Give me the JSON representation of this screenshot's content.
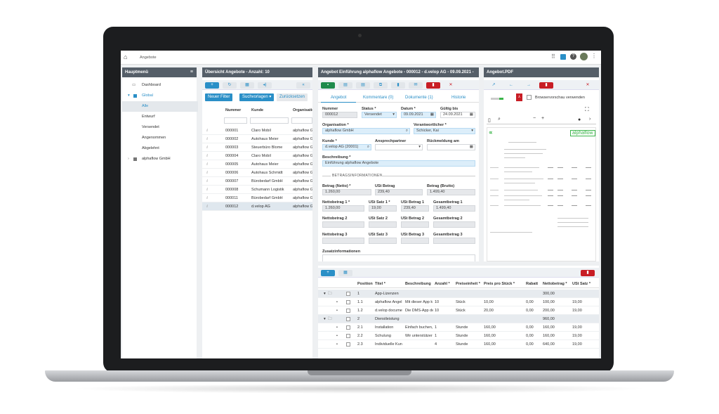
{
  "topbar": {
    "breadcrumb": "Angebote",
    "icons": [
      "home-icon",
      "apps-grid-icon",
      "gift-icon",
      "help-icon",
      "avatar",
      "more-icon"
    ]
  },
  "main_menu": {
    "title": "Hauptmenü",
    "dashboard": "Dashboard",
    "global": "Global",
    "items": [
      "Alle",
      "Entwurf",
      "Versendet",
      "Angenommen",
      "Abgelehnt"
    ],
    "company": "alphaflow GmbH"
  },
  "overview": {
    "title": "Übersicht Angebote - Anzahl: 10",
    "buttons": {
      "new_filter": "Neuer Filter",
      "search_templates": "Suchvorlagen",
      "reset": "Zurücksetzen"
    },
    "columns": [
      "Nummer",
      "Kunde",
      "Organisatio"
    ],
    "rows": [
      {
        "nr": "000001",
        "kunde": "Claro Mobil",
        "org": "alphaflow G"
      },
      {
        "nr": "000002",
        "kunde": "Autohaus Meier",
        "org": "alphaflow G"
      },
      {
        "nr": "000003",
        "kunde": "Steuerbüro Blome",
        "org": "alphaflow G"
      },
      {
        "nr": "000004",
        "kunde": "Claro Mobil",
        "org": "alphaflow G"
      },
      {
        "nr": "000005",
        "kunde": "Autohaus Meier",
        "org": "alphaflow G"
      },
      {
        "nr": "000006",
        "kunde": "Autohaus Schmidt",
        "org": "alphaflow G"
      },
      {
        "nr": "000007",
        "kunde": "Bürobedarf GmbH",
        "org": "alphaflow G"
      },
      {
        "nr": "000008",
        "kunde": "Schumann Logistik",
        "org": "alphaflow G"
      },
      {
        "nr": "000011",
        "kunde": "Bürobedarf GmbH",
        "org": "alphaflow G"
      },
      {
        "nr": "000012",
        "kunde": "d.velop AG",
        "org": "alphaflow G"
      }
    ]
  },
  "detail": {
    "title": "Angebot Einführung alphaflow Angebote - 000012 - d.velop AG - 09.09.2021 -",
    "tabs": [
      "Angebot",
      "Kommentare (0)",
      "Dokumente (1)",
      "Historie"
    ],
    "labels": {
      "nummer": "Nummer",
      "status": "Status *",
      "datum": "Datum *",
      "gueltig": "Gültig bis",
      "organisation": "Organisation *",
      "verantwortlicher": "Verantwortlicher *",
      "kunde": "Kunde *",
      "ansprechpartner": "Ansprechpartner",
      "rueckmeldung": "Rückmeldung am",
      "beschreibung": "Beschreibung *",
      "betrags_section": "BETRAGSINFORMATIONEN",
      "betrag_netto": "Betrag (Netto) *",
      "ust_betrag": "USt Betrag",
      "betrag_brutto": "Betrag (Brutto)",
      "netto1": "Nettobetrag 1 *",
      "ust_satz1": "USt Satz 1 *",
      "ust_betrag1": "USt Betrag 1",
      "gesamt1": "Gesamtbetrag 1",
      "netto2": "Nettobetrag 2",
      "ust_satz2": "USt Satz 2",
      "ust_betrag2": "USt Betrag 2",
      "gesamt2": "Gesamtbetrag 2",
      "netto3": "Nettobetrag 3",
      "ust_satz3": "USt Satz 3",
      "ust_betrag3": "USt Betrag 3",
      "gesamt3": "Gesamtbetrag 3",
      "zusatz": "Zusatzinformationen"
    },
    "values": {
      "nummer": "000012",
      "status": "Versendet",
      "datum": "09.09.2021",
      "gueltig": "24.09.2021",
      "organisation": "alphaflow GmbH",
      "verantwortlicher": "Schicker, Kai",
      "kunde": "d.velop AG (20001)",
      "beschreibung": "Einführung alphaflow Angebote",
      "betrag_netto": "1.260,00",
      "ust_betrag": "239,40",
      "betrag_brutto": "1.499,40",
      "netto1": "1.260,00",
      "ust_satz1": "19,00",
      "ust_betrag1": "239,40",
      "gesamt1": "1.499,40"
    }
  },
  "positions": {
    "columns": [
      "Position",
      "Titel *",
      "Beschreibung",
      "Anzahl *",
      "Preiseinheit *",
      "Preis pro Stück *",
      "Rabatt",
      "Nettobetrag *",
      "USt Satz *"
    ],
    "rows": [
      {
        "pos": "1",
        "titel": "App-Lizenzen",
        "besch": "",
        "anz": "",
        "einh": "",
        "preis": "",
        "rabatt": "",
        "netto": "300,00",
        "ust": "",
        "grp": true
      },
      {
        "pos": "1.1",
        "titel": "alphaflow Angel",
        "besch": "Mit dieser App k",
        "anz": "10",
        "einh": "Stück",
        "preis": "10,00",
        "rabatt": "0,00",
        "netto": "100,00",
        "ust": "19,00",
        "grp": false
      },
      {
        "pos": "1.2",
        "titel": "d.velop docume",
        "besch": "Die DMS-App de",
        "anz": "10",
        "einh": "Stück",
        "preis": "20,00",
        "rabatt": "0,00",
        "netto": "200,00",
        "ust": "19,00",
        "grp": false
      },
      {
        "pos": "2",
        "titel": "Dienstleistung",
        "besch": "",
        "anz": "",
        "einh": "",
        "preis": "",
        "rabatt": "",
        "netto": "960,00",
        "ust": "",
        "grp": true
      },
      {
        "pos": "2.1",
        "titel": "Installation",
        "besch": "Einfach buchen,",
        "anz": "1",
        "einh": "Stunde",
        "preis": "160,00",
        "rabatt": "0,00",
        "netto": "160,00",
        "ust": "19,00",
        "grp": false
      },
      {
        "pos": "2.2",
        "titel": "Schulung",
        "besch": "Wir unterstützer",
        "anz": "1",
        "einh": "Stunde",
        "preis": "160,00",
        "rabatt": "0,00",
        "netto": "160,00",
        "ust": "19,00",
        "grp": false
      },
      {
        "pos": "2.3",
        "titel": "Individuelle Kun",
        "besch": "",
        "anz": "4",
        "einh": "Stunde",
        "preis": "160,00",
        "rabatt": "0,00",
        "netto": "640,00",
        "ust": "19,00",
        "grp": false
      }
    ]
  },
  "pdf": {
    "title": "Angebot.PDF",
    "browser_preview": "Browservorschau verwenden",
    "logo": "alphaflow"
  },
  "colors": {
    "header": "#555e68",
    "accent": "#2a8fc7",
    "danger": "#c81d25",
    "save": "#1e8a4c"
  }
}
